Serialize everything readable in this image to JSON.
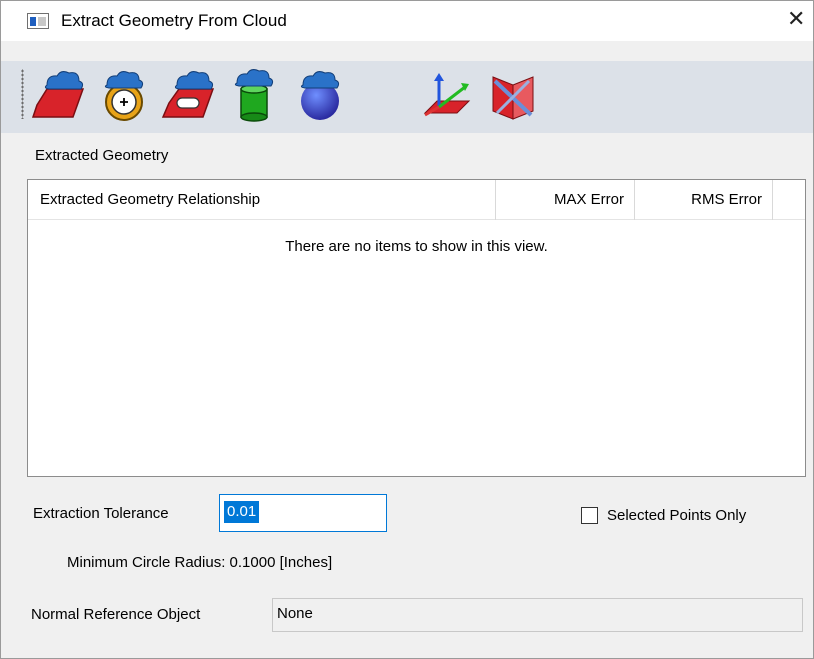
{
  "window": {
    "title": "Extract Geometry From Cloud",
    "close_glyph": "✕"
  },
  "toolbar": {
    "buttons": [
      {
        "name": "extract-plane",
        "icon": "cloud-plane-icon"
      },
      {
        "name": "extract-circle",
        "icon": "cloud-circle-icon"
      },
      {
        "name": "extract-slot",
        "icon": "cloud-slot-icon"
      },
      {
        "name": "extract-cylinder",
        "icon": "cloud-cylinder-icon"
      },
      {
        "name": "extract-sphere",
        "icon": "cloud-sphere-icon"
      },
      {
        "name": "create-frame",
        "icon": "frame-axes-icon"
      },
      {
        "name": "delete-frame",
        "icon": "frame-delete-icon"
      }
    ]
  },
  "extracted": {
    "section_label": "Extracted Geometry",
    "columns": [
      "Extracted Geometry Relationship",
      "MAX Error",
      "RMS Error"
    ],
    "rows": [],
    "empty_message": "There are no items to show in this view."
  },
  "tolerance": {
    "label": "Extraction Tolerance",
    "value": "0.01"
  },
  "selected_points_only": {
    "label": "Selected Points Only",
    "checked": false
  },
  "min_circle_radius": "Minimum Circle Radius: 0.1000 [Inches]",
  "normal_reference": {
    "label": "Normal Reference Object",
    "value": "None"
  },
  "colors": {
    "accent": "#0078d7",
    "toolbar_bg": "#dce1e8",
    "cloud_blue": "#2a72c8",
    "shape_red": "#d8232a",
    "cylinder_green": "#1fa81f",
    "circle_gold": "#e8a317"
  }
}
